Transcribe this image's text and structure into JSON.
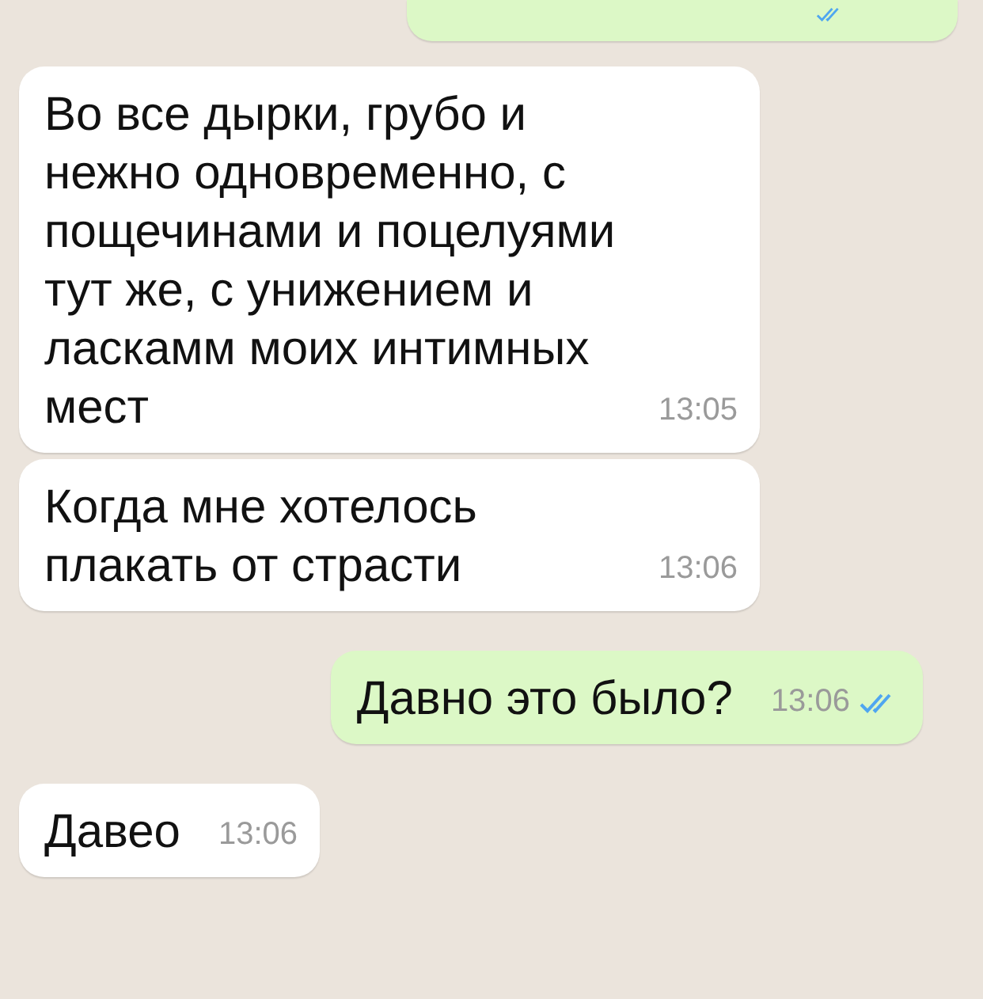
{
  "messages": [
    {
      "kind": "out",
      "read": true
    },
    {
      "kind": "in",
      "text": "Во все дырки, грубо и нежно одновременно, с пощечинами и поцелуями тут же, с унижением и ласкамм моих интимных мест",
      "time": "13:05"
    },
    {
      "kind": "in",
      "text": "Когда мне хотелось плакать от страсти",
      "time": "13:06"
    },
    {
      "kind": "out",
      "text": "Давно это было?",
      "time": "13:06",
      "read": true
    },
    {
      "kind": "in",
      "text": "Давео",
      "time": "13:06"
    }
  ]
}
